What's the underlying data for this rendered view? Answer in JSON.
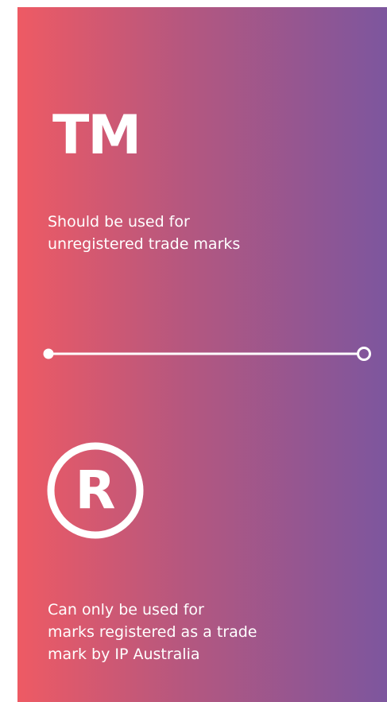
{
  "colors": {
    "gradient_start": "#ee5a64",
    "gradient_mid": "#b5577f",
    "gradient_end": "#7d569e",
    "text": "#ffffff"
  },
  "tm": {
    "symbol": "TM",
    "description_lines": [
      "Should be used for",
      "unregistered trade marks"
    ]
  },
  "divider": {
    "left_icon": "filled-dot-icon",
    "right_icon": "hollow-circle-icon"
  },
  "registered": {
    "symbol_icon": "registered-trademark-icon",
    "symbol_letter": "R",
    "description_lines": [
      "Can only be used for",
      "marks registered as a trade",
      "mark by IP Australia"
    ]
  }
}
